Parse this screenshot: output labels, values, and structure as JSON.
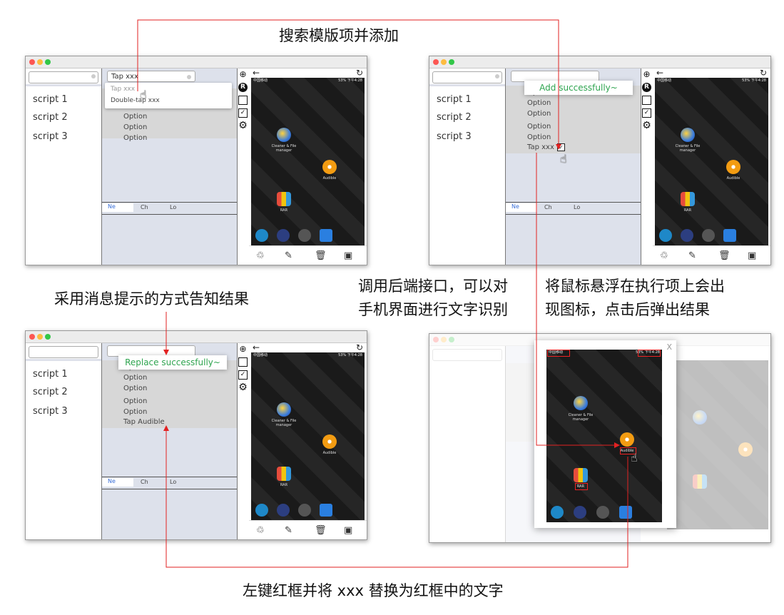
{
  "captions": {
    "top": "搜索模版项并添加",
    "left_mid": "采用消息提示的方式告知结果",
    "center_mid_1": "调用后端接口，可以对",
    "center_mid_2": "手机界面进行文字识别",
    "right_mid_1": "将鼠标悬浮在执行项上会出",
    "right_mid_2": "现图标，点击后弹出结果",
    "bottom": "左键红框并将 xxx 替换为红框中的文字"
  },
  "sidebar": {
    "scripts": [
      "script 1",
      "script 2",
      "script 3"
    ]
  },
  "tabs": [
    "Ne",
    "Ch",
    "Lo"
  ],
  "panel1": {
    "search_value": "Tap xxx",
    "dropdown": [
      "Tap xxx",
      "Double-tap xxx"
    ],
    "options": [
      "Option",
      "Option",
      "Option"
    ]
  },
  "panel2": {
    "options": [
      "Option",
      "Option",
      "Option",
      "Option",
      "Option"
    ],
    "added_item": "Tap xxx",
    "toast": "Add successfully~"
  },
  "panel3": {
    "options": [
      "Option",
      "Option",
      "Option",
      "Option",
      "Option"
    ],
    "replaced_item": "Tap Audible",
    "toast": "Replace successfully~"
  },
  "phone": {
    "carrier": "中国移动",
    "status_right": "53%  下午4:28",
    "apps": {
      "cleaner": "Cleaner & File manager",
      "audible": "Audible",
      "rar": "RAR"
    }
  },
  "modal": {
    "close": "X"
  },
  "colors": {
    "arrow": "#e22222",
    "toast_text": "#2ea44f",
    "active_tab": "#3a6fd8"
  }
}
